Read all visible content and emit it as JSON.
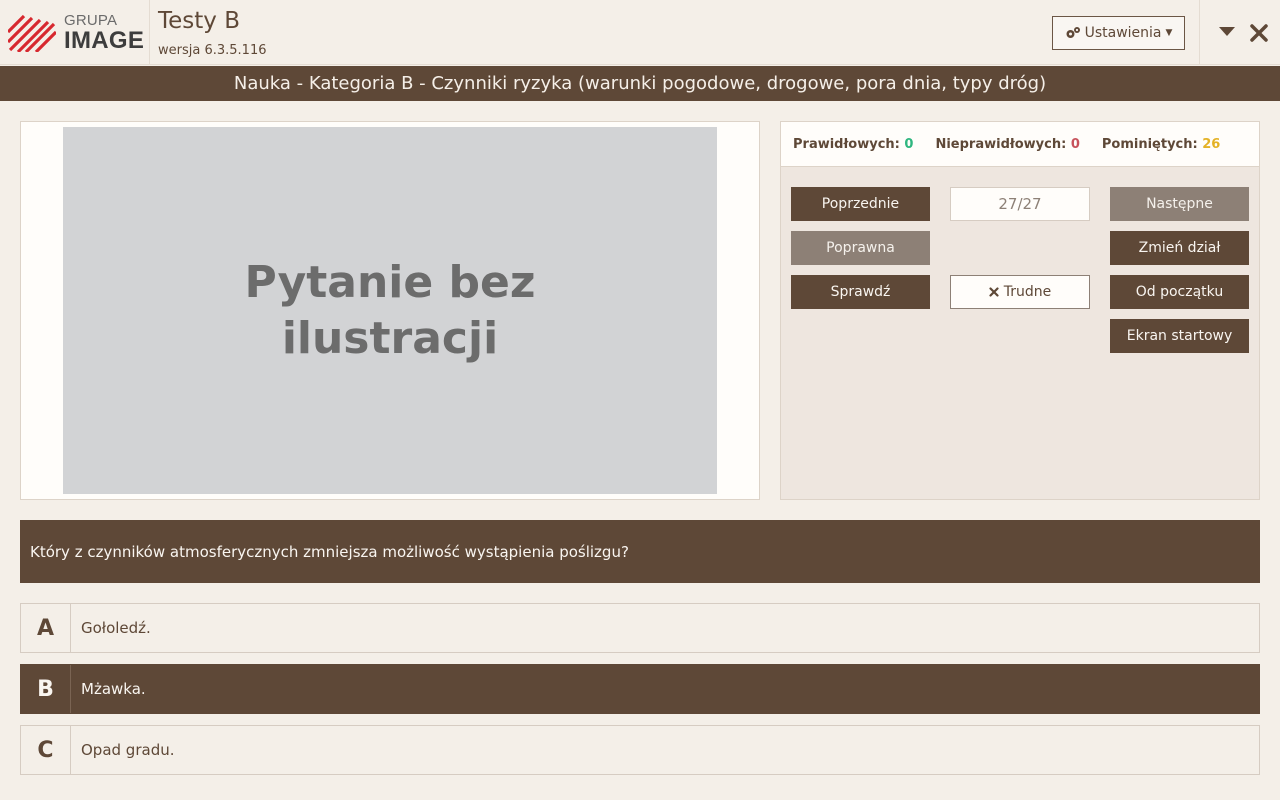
{
  "header": {
    "logo_top": "GRUPA",
    "logo_bottom": "IMAGE",
    "app_title": "Testy B",
    "version": "wersja 6.3.5.116",
    "settings_label": "Ustawienia"
  },
  "category": "Nauka - Kategoria B - Czynniki ryzyka (warunki pogodowe, drogowe, pora dnia, typy dróg)",
  "image_placeholder": "Pytanie bez ilustracji",
  "stats": {
    "correct_label": "Prawidłowych:",
    "correct_value": "0",
    "incorrect_label": "Nieprawidłowych:",
    "incorrect_value": "0",
    "skipped_label": "Pominiętych:",
    "skipped_value": "26"
  },
  "controls": {
    "previous": "Poprzednie",
    "counter": "27/27",
    "next": "Następne",
    "correct_answer": "Poprawna",
    "change_section": "Zmień dział",
    "check": "Sprawdź",
    "difficult": "Trudne",
    "from_start": "Od początku",
    "start_screen": "Ekran startowy"
  },
  "question": "Który z czynników atmosferycznych zmniejsza możliwość wystąpienia poślizgu?",
  "answers": [
    {
      "letter": "A",
      "text": "Gołoledź."
    },
    {
      "letter": "B",
      "text": "Mżawka."
    },
    {
      "letter": "C",
      "text": "Opad gradu."
    }
  ],
  "selected_answer": "B",
  "colors": {
    "brand_brown": "#5e4837",
    "muted_button": "#8d8076",
    "background": "#f4efe8",
    "correct_green": "#2fb67f",
    "incorrect_red": "#c7525b",
    "skipped_yellow": "#e4b226",
    "logo_red": "#d7282f"
  },
  "icons": {
    "settings": "gears-icon",
    "dropdown": "caret-down-icon",
    "close": "close-icon",
    "difficult": "x-mark-icon"
  }
}
